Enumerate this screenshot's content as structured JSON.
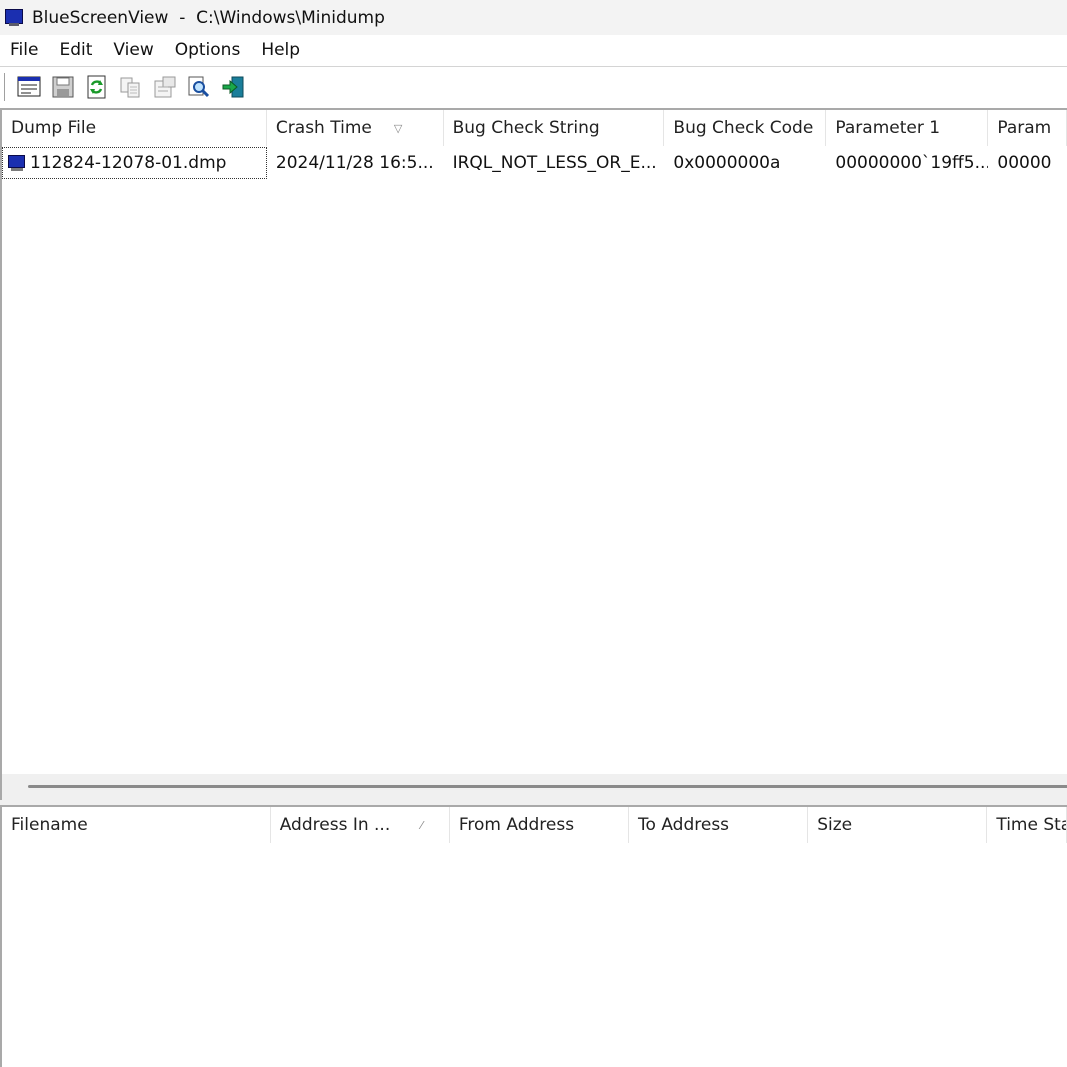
{
  "window": {
    "title": "BlueScreenView  -  C:\\Windows\\Minidump"
  },
  "menu": [
    "File",
    "Edit",
    "View",
    "Options",
    "Help"
  ],
  "toolbar": {
    "buttons": [
      "properties-icon",
      "save-icon",
      "refresh-icon",
      "copy-icon",
      "html-report-icon",
      "find-icon",
      "exit-icon"
    ]
  },
  "crash_list": {
    "columns": [
      "Dump File",
      "Crash Time",
      "Bug Check String",
      "Bug Check Code",
      "Parameter 1",
      "Param"
    ],
    "sorted_column": "Crash Time",
    "rows": [
      {
        "dump_file": "112824-12078-01.dmp",
        "crash_time": "2024/11/28 16:5...",
        "bug_check_string": "IRQL_NOT_LESS_OR_E...",
        "bug_check_code": "0x0000000a",
        "parameter_1": "00000000`19ff5...",
        "parameter_2": "00000"
      }
    ]
  },
  "driver_list": {
    "columns": [
      "Filename",
      "Address In ...",
      "From Address",
      "To Address",
      "Size",
      "Time Sta"
    ],
    "sorted_column": "Address In ...",
    "rows": []
  },
  "colors": {
    "screen_icon_blue": "#1b2fb0",
    "titlebar_bg": "#f3f3f3",
    "pane_border": "#a9a9a9"
  }
}
